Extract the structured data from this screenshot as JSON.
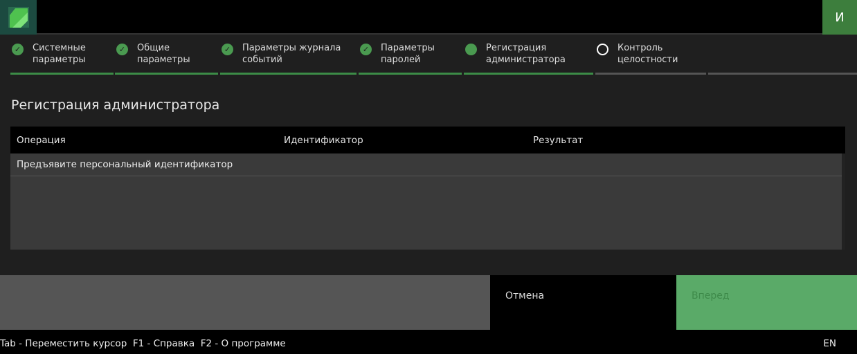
{
  "header": {
    "user_initial": "И"
  },
  "steps": [
    {
      "label": "Системные параметры",
      "state": "done"
    },
    {
      "label": "Общие параметры",
      "state": "done"
    },
    {
      "label": "Параметры журнала событий",
      "state": "done"
    },
    {
      "label": "Параметры паролей",
      "state": "done"
    },
    {
      "label": "Регистрация администратора",
      "state": "current"
    },
    {
      "label": "Контроль целостности",
      "state": "pending"
    }
  ],
  "page_title": "Регистрация администратора",
  "table": {
    "columns": [
      "Операция",
      "Идентификатор",
      "Результат"
    ],
    "rows": [
      [
        "Предъявите персональный идентификатор",
        "",
        ""
      ]
    ]
  },
  "buttons": {
    "cancel": "Отмена",
    "next": "Вперед"
  },
  "statusbar": {
    "hotkeys": "Tab - Переместить курсор  F1 - Справка  F2 - О программе",
    "language": "EN"
  },
  "colors": {
    "accent": "#4a9a50",
    "next_bg": "#5aaa68"
  }
}
